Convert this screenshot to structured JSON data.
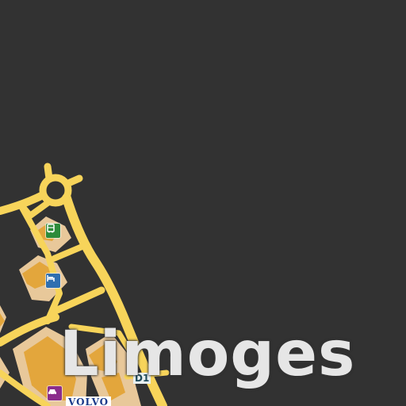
{
  "map": {
    "background_color": "#323232",
    "road_color": "#f7d45a",
    "block_color": "#e8c89a",
    "building_color": "#e3a63c",
    "place_label": "Limoges",
    "brand_label": "VOLVO",
    "road_label": "D1",
    "pois": [
      {
        "name": "bus-station-icon",
        "color": "#2e8b3a"
      },
      {
        "name": "hotel-icon",
        "color": "#2f6fb0"
      },
      {
        "name": "car-dealer-icon",
        "color": "#8b2d8c"
      }
    ]
  }
}
